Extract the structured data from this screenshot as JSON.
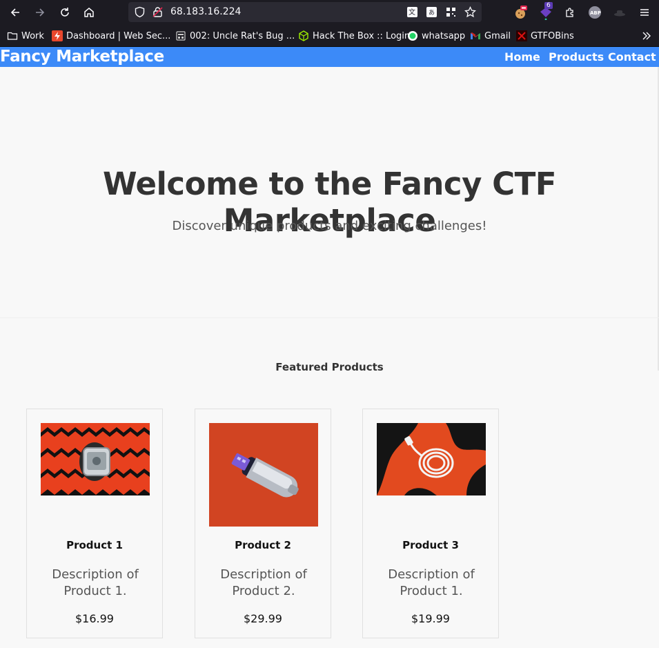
{
  "browser": {
    "url": "68.183.16.224",
    "badge_count": "6",
    "bookmarks": [
      {
        "label": "Work",
        "icon": "folder-icon"
      },
      {
        "label": "Dashboard | Web Sec...",
        "icon": "bolt-icon"
      },
      {
        "label": "002: Uncle Rat's Bug ...",
        "icon": "page-icon"
      },
      {
        "label": "Hack The Box :: Login",
        "icon": "cube-icon"
      },
      {
        "label": "whatsapp",
        "icon": "whatsapp-icon"
      },
      {
        "label": "Gmail",
        "icon": "gmail-icon"
      },
      {
        "label": "GTFOBins",
        "icon": "gtfobins-icon"
      }
    ]
  },
  "site": {
    "brand": "Fancy Marketplace",
    "nav": [
      "Home",
      "Products",
      "Contact"
    ],
    "accent": "#3c8af8"
  },
  "hero": {
    "title": "Welcome to the Fancy CTF Marketplace",
    "subtitle": "Discover unique products and exciting challenges!"
  },
  "featured": {
    "heading": "Featured Products",
    "products": [
      {
        "name": "Product 1",
        "description": "Description of Product 1.",
        "price": "$16.99",
        "image": "smartwatch"
      },
      {
        "name": "Product 2",
        "description": "Description of Product 2.",
        "price": "$29.99",
        "image": "usb-drive"
      },
      {
        "name": "Product 3",
        "description": "Description of Product 1.",
        "price": "$19.99",
        "image": "usb-cable"
      }
    ]
  }
}
